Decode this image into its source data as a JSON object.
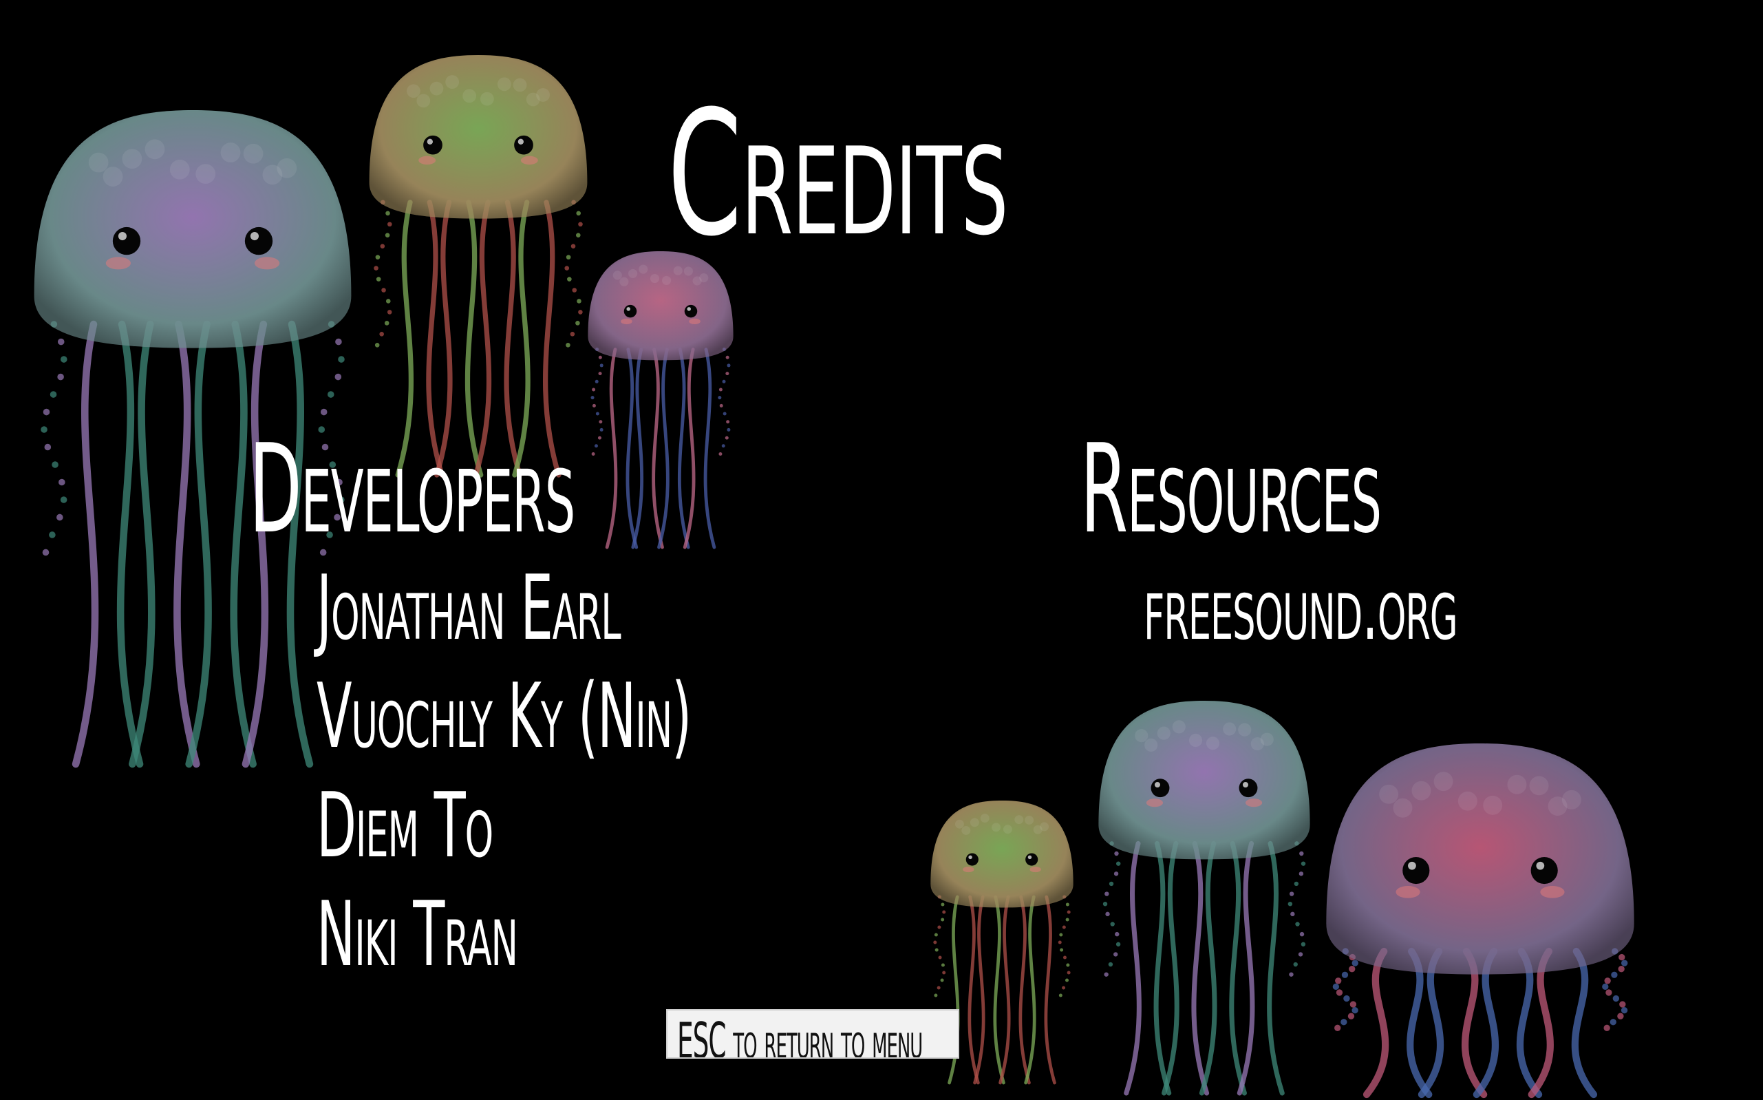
{
  "screen": {
    "title": "Credits",
    "background": "#000000"
  },
  "developers": {
    "heading": "Developers",
    "names": [
      "Jonathan Earl",
      "Vuochly Ky (Nin)",
      "Diem To",
      "Niki Tran"
    ]
  },
  "resources": {
    "heading": "Resources",
    "items": [
      "freesound.org"
    ]
  },
  "esc_button": {
    "label": "ESC to return to menu"
  },
  "decorations": [
    {
      "name": "jellyfish-large-teal",
      "bell": "#6e8f8f",
      "glow": "#9a7ab8",
      "tentacle": "#3f8a7a"
    },
    {
      "name": "jellyfish-medium-green",
      "bell": "#9e8a5e",
      "glow": "#7fae5a",
      "tentacle": "#b0504a"
    },
    {
      "name": "jellyfish-small-purple",
      "bell": "#8a6a8e",
      "glow": "#c06a8a",
      "tentacle": "#4a5ea8"
    },
    {
      "name": "jellyfish-small-green",
      "bell": "#9e8a5e",
      "glow": "#7fae5a",
      "tentacle": "#b0504a"
    },
    {
      "name": "jellyfish-medium-teal",
      "bell": "#6e8f8f",
      "glow": "#9a7ab8",
      "tentacle": "#3f8a7a"
    },
    {
      "name": "jellyfish-large-pink",
      "bell": "#7a6a8e",
      "glow": "#c05a7a",
      "tentacle": "#4a6ab0"
    }
  ]
}
